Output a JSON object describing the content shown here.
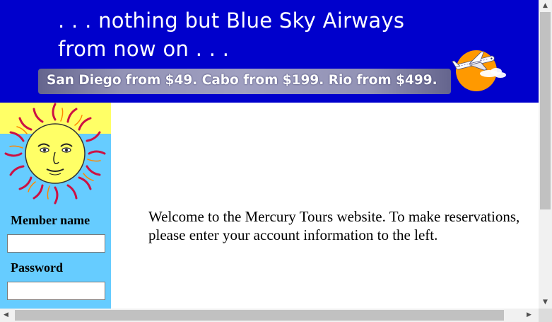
{
  "banner": {
    "line1": ". . . nothing but Blue Sky Airways",
    "line2": "from now on . . .",
    "promo": "San Diego from $49. Cabo from $199. Rio from $499.",
    "logo_icon": "airplane-sun-logo",
    "background_color": "#0000cc"
  },
  "sidebar": {
    "image_icon": "sun-face-icon",
    "member_label": "Member name",
    "member_value": "",
    "password_label": "Password",
    "password_value": "",
    "background_color": "#66ccff"
  },
  "main": {
    "welcome_text": "Welcome to the Mercury Tours website. To make reservations, please enter your account information to the left."
  },
  "scrollbars": {
    "vertical_up_icon": "scroll-up-arrow-icon",
    "vertical_down_icon": "scroll-down-arrow-icon",
    "horizontal_left_icon": "scroll-left-arrow-icon",
    "horizontal_right_icon": "scroll-right-arrow-icon"
  }
}
